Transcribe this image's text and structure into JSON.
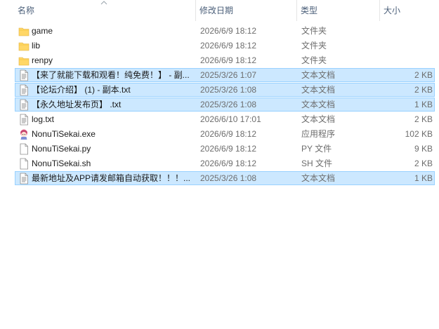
{
  "columns": {
    "name": "名称",
    "date": "修改日期",
    "type": "类型",
    "size": "大小"
  },
  "colors": {
    "selected_bg": "#cce8ff",
    "selected_border": "#99d1ff",
    "folder": "#ffd767"
  },
  "files": [
    {
      "name": "game",
      "date": "2026/6/9 18:12",
      "type": "文件夹",
      "size": "",
      "icon": "folder-icon",
      "selected": false
    },
    {
      "name": "lib",
      "date": "2026/6/9 18:12",
      "type": "文件夹",
      "size": "",
      "icon": "folder-icon",
      "selected": false
    },
    {
      "name": "renpy",
      "date": "2026/6/9 18:12",
      "type": "文件夹",
      "size": "",
      "icon": "folder-icon",
      "selected": false
    },
    {
      "name": "【来了就能下载和观看！纯免费！】 - 副...",
      "date": "2025/3/26 1:07",
      "type": "文本文档",
      "size": "2 KB",
      "icon": "text-file-icon",
      "selected": true
    },
    {
      "name": "【论坛介绍】 (1) - 副本.txt",
      "date": "2025/3/26 1:08",
      "type": "文本文档",
      "size": "2 KB",
      "icon": "text-file-icon",
      "selected": true
    },
    {
      "name": "【永久地址发布页】 .txt",
      "date": "2025/3/26 1:08",
      "type": "文本文档",
      "size": "1 KB",
      "icon": "text-file-icon",
      "selected": true
    },
    {
      "name": "log.txt",
      "date": "2026/6/10 17:01",
      "type": "文本文档",
      "size": "2 KB",
      "icon": "text-file-icon",
      "selected": false
    },
    {
      "name": "NonuTiSekai.exe",
      "date": "2026/6/9 18:12",
      "type": "应用程序",
      "size": "102 KB",
      "icon": "app-icon",
      "selected": false
    },
    {
      "name": "NonuTiSekai.py",
      "date": "2026/6/9 18:12",
      "type": "PY 文件",
      "size": "9 KB",
      "icon": "blank-file-icon",
      "selected": false
    },
    {
      "name": "NonuTiSekai.sh",
      "date": "2026/6/9 18:12",
      "type": "SH 文件",
      "size": "2 KB",
      "icon": "blank-file-icon",
      "selected": false
    },
    {
      "name": "最新地址及APP请发邮箱自动获取！！！...",
      "date": "2025/3/26 1:08",
      "type": "文本文档",
      "size": "1 KB",
      "icon": "text-file-icon",
      "selected": true
    }
  ]
}
